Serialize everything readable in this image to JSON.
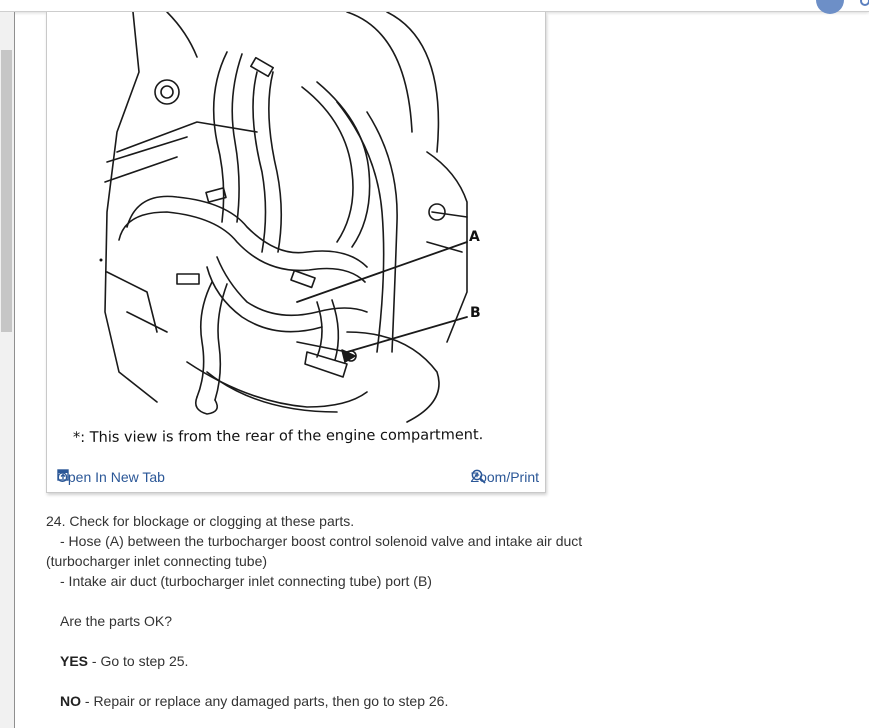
{
  "figure": {
    "callout_a": "A",
    "callout_b": "B",
    "caption": "*: This view is from the rear of the engine compartment.",
    "open_tab_label": "Open In New Tab",
    "zoom_label": "Zoom/Print"
  },
  "step": {
    "heading": "24. Check for blockage or clogging at these parts.",
    "item1_line1": "-  Hose (A) between the turbocharger boost control solenoid valve and intake air duct",
    "item1_line2": "(turbocharger inlet connecting tube)",
    "item2": "-  Intake air duct (turbocharger inlet connecting tube) port (B)",
    "question": "Are the parts OK?",
    "yes_label": "YES",
    "yes_text": " - Go to step 25.",
    "no_label": "NO",
    "no_text": " - Repair or replace any damaged parts, then go to step 26."
  },
  "colors": {
    "link": "#2b5797",
    "text": "#333333",
    "avatar": "#6d8fc7"
  },
  "icons": {
    "open_tab": "open-new-tab-icon",
    "zoom": "zoom-in-icon"
  }
}
